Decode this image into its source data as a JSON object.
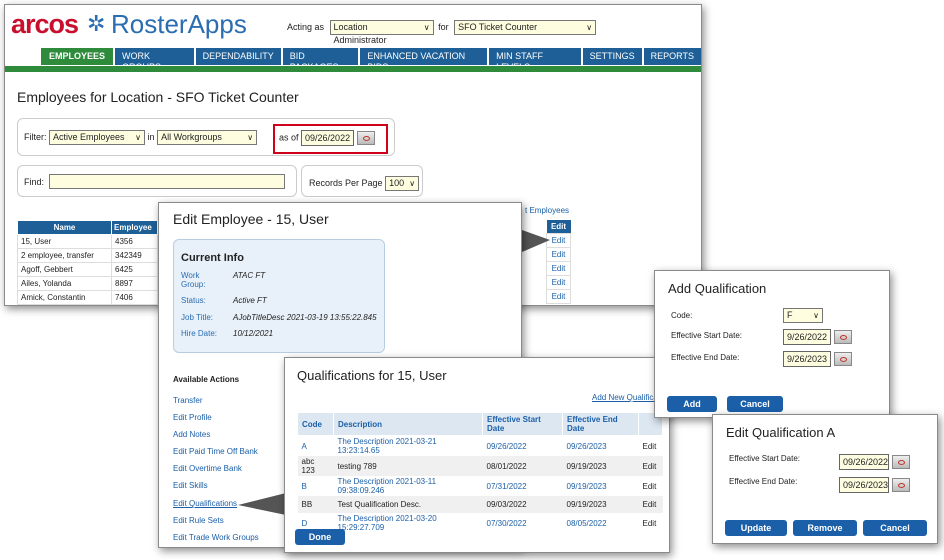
{
  "brand": {
    "logo": "arcos",
    "app": "RosterApps"
  },
  "header": {
    "acting_as_label": "Acting as",
    "role": "Location Administrator",
    "for_label": "for",
    "location": "SFO Ticket Counter"
  },
  "nav": {
    "tabs": [
      "EMPLOYEES",
      "WORK GROUPS",
      "DEPENDABILITY",
      "BID PACKAGES",
      "ENHANCED VACATION BIDS",
      "MIN STAFF LEVELS",
      "SETTINGS",
      "REPORTS"
    ],
    "active": "EMPLOYEES"
  },
  "main": {
    "title": "Employees for Location - SFO Ticket Counter",
    "filter_label": "Filter:",
    "filter_value": "Active Employees",
    "in_label": "in",
    "workgroup_value": "All Workgroups",
    "as_of_label": "as of",
    "as_of_date": "09/26/2022",
    "find_label": "Find:",
    "records_label": "Records Per Page",
    "records_value": "100",
    "link_partial": "t Employees",
    "col_name": "Name",
    "col_employee": "Employee",
    "col_edit": "Edit",
    "rows": [
      {
        "name": "15, User",
        "id": "4356"
      },
      {
        "name": "2 employee, transfer",
        "id": "342349"
      },
      {
        "name": "Agoff, Gebbert",
        "id": "6425"
      },
      {
        "name": "Ailes, Yolanda",
        "id": "8897"
      },
      {
        "name": "Amick, Constantin",
        "id": "7406"
      }
    ],
    "edit_label": "Edit"
  },
  "edit_employee": {
    "title": "Edit Employee - 15, User",
    "current_info_title": "Current Info",
    "fields": [
      {
        "label": "Work Group:",
        "value": "ATAC FT"
      },
      {
        "label": "Status:",
        "value": "Active FT"
      },
      {
        "label": "Job Title:",
        "value": "AJobTitleDesc 2021-03-19 13:55:22.845"
      },
      {
        "label": "Hire Date:",
        "value": "10/12/2021"
      }
    ],
    "actions_title": "Available Actions",
    "actions": [
      "Transfer",
      "Edit Profile",
      "Add Notes",
      "Edit Paid Time Off Bank",
      "Edit Overtime Bank",
      "Edit Skills",
      "Edit Qualifications",
      "Edit Rule Sets",
      "Edit Trade Work Groups"
    ]
  },
  "qualifications": {
    "title": "Qualifications for 15, User",
    "add_link": "Add New Qualifica",
    "headers": [
      "Code",
      "Description",
      "Effective Start Date",
      "Effective End Date",
      ""
    ],
    "rows": [
      {
        "code": "A",
        "desc": "The Description 2021-03-21 13:23:14.65",
        "start": "09/26/2022",
        "end": "09/26/2023",
        "edit": "Edit"
      },
      {
        "code": "abc 123",
        "desc": "testing 789",
        "start": "08/01/2022",
        "end": "09/19/2023",
        "edit": "Edit"
      },
      {
        "code": "B",
        "desc": "The Description 2021-03-11 09:38:09.246",
        "start": "07/31/2022",
        "end": "09/19/2023",
        "edit": "Edit"
      },
      {
        "code": "BB",
        "desc": "Test Qualification Desc.",
        "start": "09/03/2022",
        "end": "09/19/2023",
        "edit": "Edit"
      },
      {
        "code": "D",
        "desc": "The Description 2021-03-20 15:29:27.709",
        "start": "07/30/2022",
        "end": "08/05/2022",
        "edit": "Edit"
      }
    ],
    "done": "Done"
  },
  "add_qual": {
    "title": "Add Qualification",
    "code_label": "Code:",
    "code_value": "F",
    "start_label": "Effective Start Date:",
    "start_value": "9/26/2022",
    "end_label": "Effective End Date:",
    "end_value": "9/26/2023",
    "add": "Add",
    "cancel": "Cancel"
  },
  "edit_qual": {
    "title": "Edit Qualification A",
    "start_label": "Effective Start Date:",
    "start_value": "09/26/2022",
    "end_label": "Effective End Date:",
    "end_value": "09/26/2023",
    "update": "Update",
    "remove": "Remove",
    "cancel": "Cancel"
  },
  "colors": {
    "tab_blue": "#1d5f96",
    "tab_active": "#2e8b3c",
    "brand_red": "#c8102e",
    "brand_blue": "#2a6db0",
    "highlight_red": "#d0021b"
  }
}
